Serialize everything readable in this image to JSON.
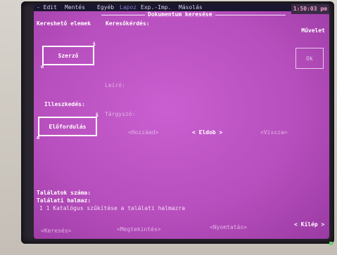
{
  "menu": {
    "items": [
      "- Edit",
      "Mentés",
      "Egyéb",
      "Lapoz",
      "Exp.-Imp.",
      "Másolás"
    ]
  },
  "clock": "1:50:03 pm",
  "window": {
    "title": "Dokumentum keresése"
  },
  "left": {
    "header": "Kereshető elemek",
    "author_box": "Szerző",
    "join_label": "Illeszkedés:",
    "occurrence_box": "Előfordulás"
  },
  "query": {
    "header": "Keresőkérdés:",
    "descriptor": "Leíró:",
    "subject": "Tárgyszó:"
  },
  "right": {
    "operation_header": "Művelet",
    "ok_button": "Ok"
  },
  "actions": {
    "add": "<Hozzáad>",
    "remove": "< Eldob >",
    "back": "<Vissza>"
  },
  "results": {
    "count_label": "Találatok száma:",
    "set_label": "Találati halmaz:",
    "set_desc": "1  1 Katalógus szűkítése a találati halmazra"
  },
  "bottom": {
    "search": "<Keresés>",
    "view": "<Megtekintés>",
    "print": "<Nyomtatás>",
    "exit": "< Kilép >"
  }
}
